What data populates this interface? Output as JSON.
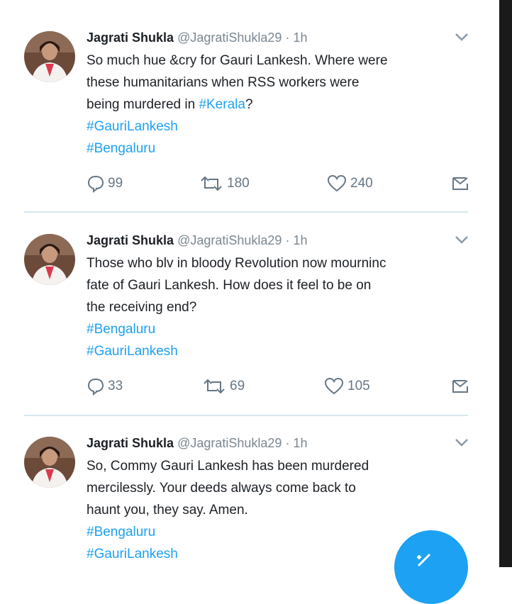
{
  "tweets": [
    {
      "name": "Jagrati Shukla",
      "handle": "@JagratiShukla29",
      "time": "· 1h",
      "lines": [
        {
          "text": "So much hue &cry for Gauri Lankesh. Where were"
        },
        {
          "text": "these humanitarians when RSS workers were"
        },
        {
          "text": "being murdered in ",
          "tag": "#Kerala",
          "after": "?"
        },
        {
          "tag": "#GauriLankesh"
        },
        {
          "tag": "#Bengaluru"
        }
      ],
      "replies": "99",
      "retweets": "180",
      "likes": "240"
    },
    {
      "name": "Jagrati Shukla",
      "handle": "@JagratiShukla29",
      "time": "· 1h",
      "lines": [
        {
          "text": "Those who blv in bloody Revolution now mourninc"
        },
        {
          "text": "fate of Gauri Lankesh. How does it feel to be on"
        },
        {
          "text": "the receiving end?"
        },
        {
          "tag": "#Bengaluru"
        },
        {
          "tag": "#GauriLankesh"
        }
      ],
      "replies": "33",
      "retweets": "69",
      "likes": "105"
    },
    {
      "name": "Jagrati Shukla",
      "handle": "@JagratiShukla29",
      "time": "· 1h",
      "lines": [
        {
          "text": "So, Commy Gauri Lankesh has been murdered"
        },
        {
          "text": "mercilessly. Your deeds always come back to"
        },
        {
          "text": "haunt you, they say. Amen."
        },
        {
          "tag": "#Bengaluru"
        },
        {
          "tag": "#GauriLankesh"
        }
      ]
    }
  ],
  "icons": {
    "reply": "reply-icon",
    "retweet": "retweet-icon",
    "like": "heart-icon",
    "dm": "direct-message-icon",
    "menu": "chevron-down-icon",
    "compose": "compose-tweet-icon"
  },
  "colors": {
    "link": "#1da1f2",
    "text": "#1c2025",
    "muted": "#657786",
    "divider": "#d7e8ef"
  }
}
